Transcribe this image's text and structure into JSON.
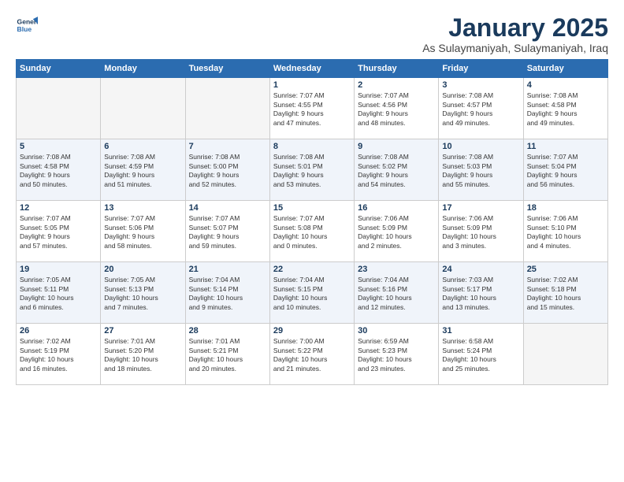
{
  "logo": {
    "line1": "General",
    "line2": "Blue"
  },
  "title": "January 2025",
  "subtitle": "As Sulaymaniyah, Sulaymaniyah, Iraq",
  "headers": [
    "Sunday",
    "Monday",
    "Tuesday",
    "Wednesday",
    "Thursday",
    "Friday",
    "Saturday"
  ],
  "weeks": [
    [
      {
        "day": "",
        "info": ""
      },
      {
        "day": "",
        "info": ""
      },
      {
        "day": "",
        "info": ""
      },
      {
        "day": "1",
        "info": "Sunrise: 7:07 AM\nSunset: 4:55 PM\nDaylight: 9 hours\nand 47 minutes."
      },
      {
        "day": "2",
        "info": "Sunrise: 7:07 AM\nSunset: 4:56 PM\nDaylight: 9 hours\nand 48 minutes."
      },
      {
        "day": "3",
        "info": "Sunrise: 7:08 AM\nSunset: 4:57 PM\nDaylight: 9 hours\nand 49 minutes."
      },
      {
        "day": "4",
        "info": "Sunrise: 7:08 AM\nSunset: 4:58 PM\nDaylight: 9 hours\nand 49 minutes."
      }
    ],
    [
      {
        "day": "5",
        "info": "Sunrise: 7:08 AM\nSunset: 4:58 PM\nDaylight: 9 hours\nand 50 minutes."
      },
      {
        "day": "6",
        "info": "Sunrise: 7:08 AM\nSunset: 4:59 PM\nDaylight: 9 hours\nand 51 minutes."
      },
      {
        "day": "7",
        "info": "Sunrise: 7:08 AM\nSunset: 5:00 PM\nDaylight: 9 hours\nand 52 minutes."
      },
      {
        "day": "8",
        "info": "Sunrise: 7:08 AM\nSunset: 5:01 PM\nDaylight: 9 hours\nand 53 minutes."
      },
      {
        "day": "9",
        "info": "Sunrise: 7:08 AM\nSunset: 5:02 PM\nDaylight: 9 hours\nand 54 minutes."
      },
      {
        "day": "10",
        "info": "Sunrise: 7:08 AM\nSunset: 5:03 PM\nDaylight: 9 hours\nand 55 minutes."
      },
      {
        "day": "11",
        "info": "Sunrise: 7:07 AM\nSunset: 5:04 PM\nDaylight: 9 hours\nand 56 minutes."
      }
    ],
    [
      {
        "day": "12",
        "info": "Sunrise: 7:07 AM\nSunset: 5:05 PM\nDaylight: 9 hours\nand 57 minutes."
      },
      {
        "day": "13",
        "info": "Sunrise: 7:07 AM\nSunset: 5:06 PM\nDaylight: 9 hours\nand 58 minutes."
      },
      {
        "day": "14",
        "info": "Sunrise: 7:07 AM\nSunset: 5:07 PM\nDaylight: 9 hours\nand 59 minutes."
      },
      {
        "day": "15",
        "info": "Sunrise: 7:07 AM\nSunset: 5:08 PM\nDaylight: 10 hours\nand 0 minutes."
      },
      {
        "day": "16",
        "info": "Sunrise: 7:06 AM\nSunset: 5:09 PM\nDaylight: 10 hours\nand 2 minutes."
      },
      {
        "day": "17",
        "info": "Sunrise: 7:06 AM\nSunset: 5:09 PM\nDaylight: 10 hours\nand 3 minutes."
      },
      {
        "day": "18",
        "info": "Sunrise: 7:06 AM\nSunset: 5:10 PM\nDaylight: 10 hours\nand 4 minutes."
      }
    ],
    [
      {
        "day": "19",
        "info": "Sunrise: 7:05 AM\nSunset: 5:11 PM\nDaylight: 10 hours\nand 6 minutes."
      },
      {
        "day": "20",
        "info": "Sunrise: 7:05 AM\nSunset: 5:13 PM\nDaylight: 10 hours\nand 7 minutes."
      },
      {
        "day": "21",
        "info": "Sunrise: 7:04 AM\nSunset: 5:14 PM\nDaylight: 10 hours\nand 9 minutes."
      },
      {
        "day": "22",
        "info": "Sunrise: 7:04 AM\nSunset: 5:15 PM\nDaylight: 10 hours\nand 10 minutes."
      },
      {
        "day": "23",
        "info": "Sunrise: 7:04 AM\nSunset: 5:16 PM\nDaylight: 10 hours\nand 12 minutes."
      },
      {
        "day": "24",
        "info": "Sunrise: 7:03 AM\nSunset: 5:17 PM\nDaylight: 10 hours\nand 13 minutes."
      },
      {
        "day": "25",
        "info": "Sunrise: 7:02 AM\nSunset: 5:18 PM\nDaylight: 10 hours\nand 15 minutes."
      }
    ],
    [
      {
        "day": "26",
        "info": "Sunrise: 7:02 AM\nSunset: 5:19 PM\nDaylight: 10 hours\nand 16 minutes."
      },
      {
        "day": "27",
        "info": "Sunrise: 7:01 AM\nSunset: 5:20 PM\nDaylight: 10 hours\nand 18 minutes."
      },
      {
        "day": "28",
        "info": "Sunrise: 7:01 AM\nSunset: 5:21 PM\nDaylight: 10 hours\nand 20 minutes."
      },
      {
        "day": "29",
        "info": "Sunrise: 7:00 AM\nSunset: 5:22 PM\nDaylight: 10 hours\nand 21 minutes."
      },
      {
        "day": "30",
        "info": "Sunrise: 6:59 AM\nSunset: 5:23 PM\nDaylight: 10 hours\nand 23 minutes."
      },
      {
        "day": "31",
        "info": "Sunrise: 6:58 AM\nSunset: 5:24 PM\nDaylight: 10 hours\nand 25 minutes."
      },
      {
        "day": "",
        "info": ""
      }
    ]
  ]
}
